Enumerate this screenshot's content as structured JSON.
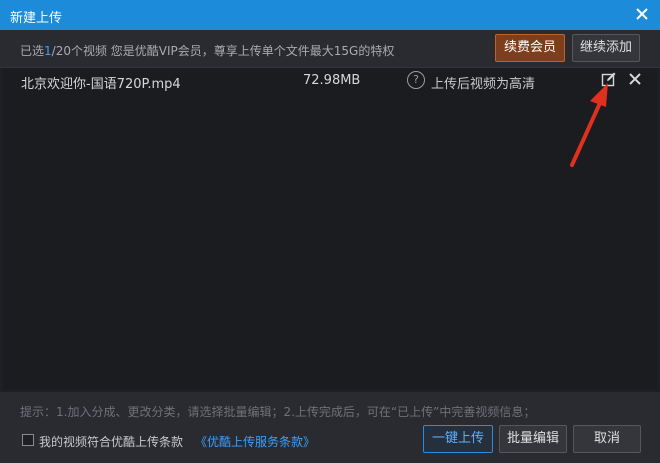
{
  "window": {
    "title": "新建上传",
    "accent": "#1c8bd9"
  },
  "infobar": {
    "prefix": "已选",
    "selected": "1",
    "suffix": "/20个视频  您是优酷VIP会员，尊享上传单个文件最大15G的特权",
    "renew_label": "续费会员",
    "add_label": "继续添加"
  },
  "files": [
    {
      "name": "北京欢迎你-国语720P.mp4",
      "size": "72.98MB",
      "help_glyph": "?",
      "hint": "上传后视频为高清"
    }
  ],
  "footer": {
    "tip": "提示：1.加入分成、更改分类，请选择批量编辑；2.上传完成后，可在“已上传”中完善视频信息；",
    "agree_text": "我的视频符合优酷上传条款",
    "agree_link": "《优酷上传服务条款》",
    "upload_label": "一键上传",
    "batch_label": "批量编辑",
    "cancel_label": "取消"
  },
  "icons": {
    "close": "close-icon",
    "edit": "edit-icon",
    "delete": "delete-icon",
    "help": "help-icon",
    "arrow": "red-arrow-annotation"
  }
}
